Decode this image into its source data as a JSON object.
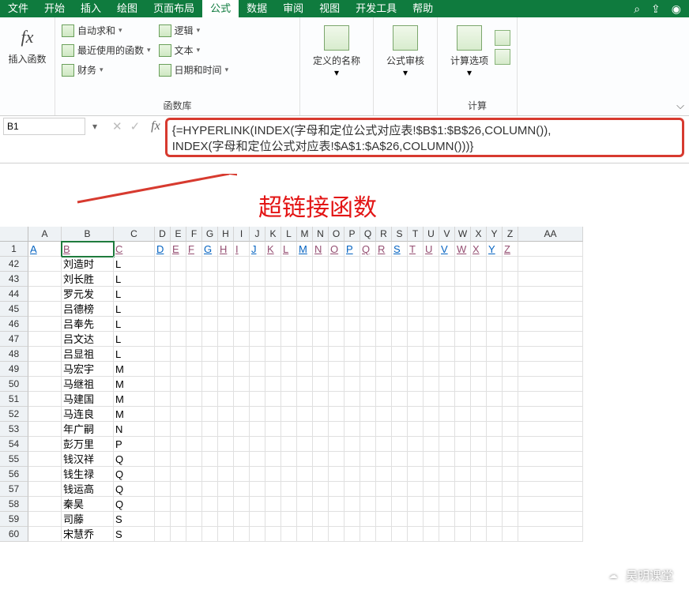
{
  "menu": {
    "tabs": [
      "文件",
      "开始",
      "插入",
      "绘图",
      "页面布局",
      "公式",
      "数据",
      "审阅",
      "视图",
      "开发工具",
      "帮助"
    ],
    "active": 5
  },
  "ribbon": {
    "fx_label": "插入函数",
    "lib": [
      [
        "自动求和",
        "最近使用的函数",
        "财务"
      ],
      [
        "逻辑",
        "文本",
        "日期和时间"
      ]
    ],
    "lib_label": "函数库",
    "big": [
      "定义的名称",
      "公式审核",
      "计算选项"
    ],
    "calc_label": "计算"
  },
  "fbar": {
    "name_box": "B1",
    "formula": "{=HYPERLINK(INDEX(字母和定位公式对应表!$B$1:$B$26,COLUMN()),\nINDEX(字母和定位公式对应表!$A$1:$A$26,COLUMN()))}"
  },
  "annotation": "超链接函数",
  "columns": [
    "A",
    "B",
    "C",
    "D",
    "E",
    "F",
    "G",
    "H",
    "I",
    "J",
    "K",
    "L",
    "M",
    "N",
    "O",
    "P",
    "Q",
    "R",
    "S",
    "T",
    "U",
    "V",
    "W",
    "X",
    "Y",
    "Z",
    "AA"
  ],
  "linkrow": [
    "A",
    "B",
    "C",
    "D",
    "E",
    "F",
    "G",
    "H",
    "I",
    "J",
    "K",
    "L",
    "M",
    "N",
    "O",
    "P",
    "Q",
    "R",
    "S",
    "T",
    "U",
    "V",
    "W",
    "X",
    "Y",
    "Z",
    ""
  ],
  "rows": [
    {
      "n": 42,
      "b": "刘造时",
      "c": "L"
    },
    {
      "n": 43,
      "b": "刘长胜",
      "c": "L"
    },
    {
      "n": 44,
      "b": "罗元发",
      "c": "L"
    },
    {
      "n": 45,
      "b": "吕德榜",
      "c": "L"
    },
    {
      "n": 46,
      "b": "吕奉先",
      "c": "L"
    },
    {
      "n": 47,
      "b": "吕文达",
      "c": "L"
    },
    {
      "n": 48,
      "b": "吕显祖",
      "c": "L"
    },
    {
      "n": 49,
      "b": "马宏宇",
      "c": "M"
    },
    {
      "n": 50,
      "b": "马继祖",
      "c": "M"
    },
    {
      "n": 51,
      "b": "马建国",
      "c": "M"
    },
    {
      "n": 52,
      "b": "马连良",
      "c": "M"
    },
    {
      "n": 53,
      "b": "年广嗣",
      "c": "N"
    },
    {
      "n": 54,
      "b": "彭万里",
      "c": "P"
    },
    {
      "n": 55,
      "b": "钱汉祥",
      "c": "Q"
    },
    {
      "n": 56,
      "b": "钱生禄",
      "c": "Q"
    },
    {
      "n": 57,
      "b": "钱运高",
      "c": "Q"
    },
    {
      "n": 58,
      "b": "秦昊",
      "c": "Q"
    },
    {
      "n": 59,
      "b": "司藤",
      "c": "S"
    },
    {
      "n": 60,
      "b": "宋慧乔",
      "c": "S"
    }
  ],
  "watermark": "吴明课堂"
}
